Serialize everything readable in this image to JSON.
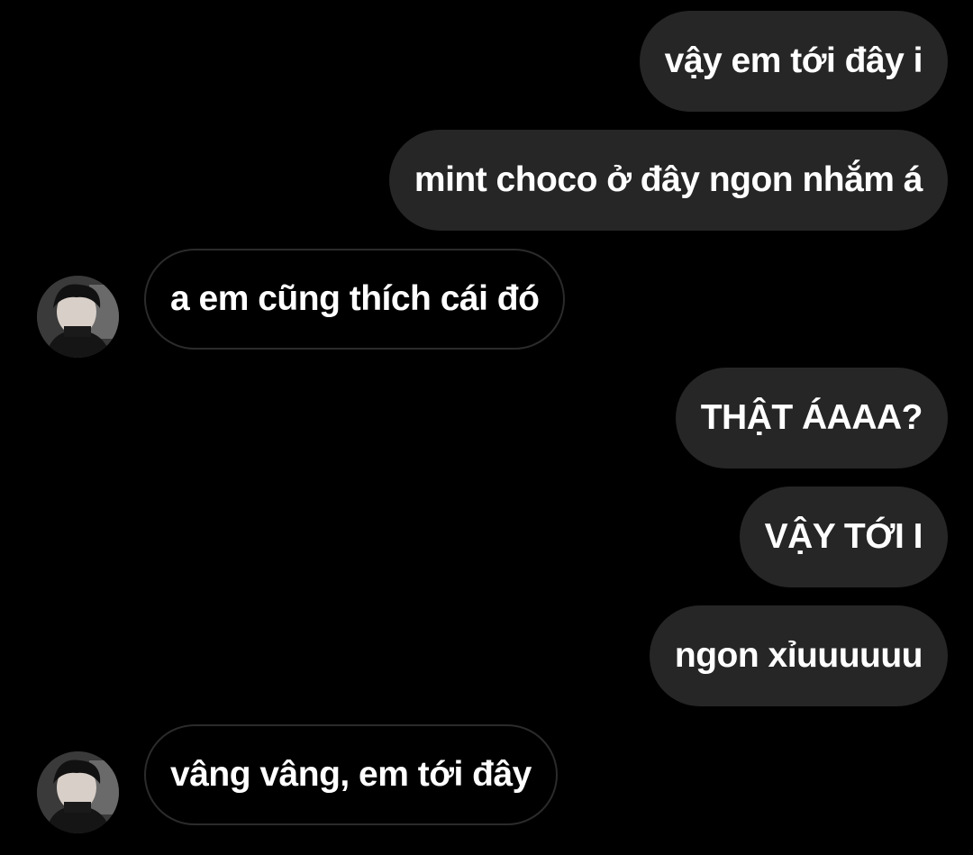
{
  "conversation": {
    "messages": [
      {
        "sender": "me",
        "text": "vậy em tới đây i"
      },
      {
        "sender": "me",
        "text": "mint choco ở đây ngon nhắm á"
      },
      {
        "sender": "other",
        "text": "a em cũng thích cái đó"
      },
      {
        "sender": "me",
        "text": "THẬT ÁAAA?"
      },
      {
        "sender": "me",
        "text": "VẬY TỚI I"
      },
      {
        "sender": "me",
        "text": "ngon xỉuuuuuu"
      },
      {
        "sender": "other",
        "text": "vâng vâng, em tới đây"
      }
    ]
  },
  "colors": {
    "background": "#000000",
    "sent_bubble": "#262626",
    "received_bubble_border": "#2b2b2b",
    "text": "#ffffff"
  },
  "icons": {
    "avatar": "profile-photo"
  }
}
